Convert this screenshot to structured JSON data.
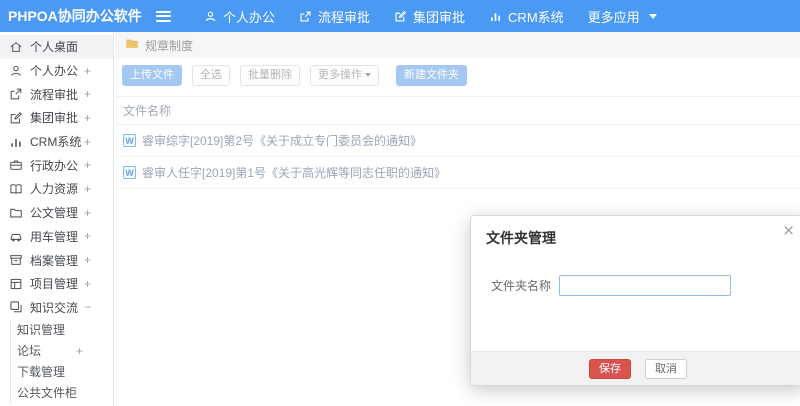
{
  "navbar": {
    "logo": "PHPOA协同办公软件",
    "items": [
      {
        "label": "个人办公",
        "icon": "user-icon"
      },
      {
        "label": "流程审批",
        "icon": "workflow-icon"
      },
      {
        "label": "集团审批",
        "icon": "edit-square-icon"
      },
      {
        "label": "CRM系统",
        "icon": "bar-chart-icon"
      },
      {
        "label": "更多应用",
        "icon": "caret-down-icon"
      }
    ]
  },
  "sidebar": {
    "items": [
      {
        "label": "个人桌面",
        "expand": "",
        "icon": "home-icon",
        "active": true
      },
      {
        "label": "个人办公",
        "expand": "+",
        "icon": "user-icon"
      },
      {
        "label": "流程审批",
        "expand": "+",
        "icon": "workflow-icon"
      },
      {
        "label": "集团审批",
        "expand": "+",
        "icon": "edit-square-icon"
      },
      {
        "label": "CRM系统",
        "expand": "+",
        "icon": "bar-chart-icon"
      },
      {
        "label": "行政办公",
        "expand": "+",
        "icon": "briefcase-icon"
      },
      {
        "label": "人力资源",
        "expand": "+",
        "icon": "book-icon"
      },
      {
        "label": "公文管理",
        "expand": "+",
        "icon": "folder-icon"
      },
      {
        "label": "用车管理",
        "expand": "+",
        "icon": "car-icon"
      },
      {
        "label": "档案管理",
        "expand": "+",
        "icon": "archive-icon"
      },
      {
        "label": "项目管理",
        "expand": "+",
        "icon": "project-icon"
      },
      {
        "label": "知识交流",
        "expand": "−",
        "icon": "copy-icon"
      }
    ],
    "submenu": [
      {
        "label": "知识管理",
        "expand": ""
      },
      {
        "label": "论坛",
        "expand": "+"
      },
      {
        "label": "下载管理",
        "expand": ""
      },
      {
        "label": "公共文件柜",
        "expand": ""
      }
    ]
  },
  "breadcrumb": {
    "label": "规章制度",
    "icon": "folder-icon"
  },
  "toolbar": {
    "upload": "上传文件",
    "select_all": "全选",
    "batch_delete": "批量删除",
    "more_actions": "更多操作",
    "new_folder": "新建文件夹"
  },
  "file_table": {
    "header": "文件名称",
    "rows": [
      {
        "icon": "word-doc-icon",
        "icon_letter": "W",
        "name": "睿审综字[2019]第2号《关于成立专门委员会的通知》"
      },
      {
        "icon": "word-doc-icon",
        "icon_letter": "W",
        "name": "睿审人任字[2019]第1号《关于高光辉等同志任职的通知》"
      }
    ]
  },
  "modal": {
    "title": "文件夹管理",
    "close": "×",
    "field_label": "文件夹名称",
    "input_value": "",
    "save": "保存",
    "cancel": "取消"
  },
  "colors": {
    "navbar_blue": "#4a9af4",
    "primary_button_blue": "#a5c8f2",
    "save_red": "#d9534f",
    "folder_yellow": "#f0c469",
    "row_text_gray": "#9aa5b5"
  }
}
